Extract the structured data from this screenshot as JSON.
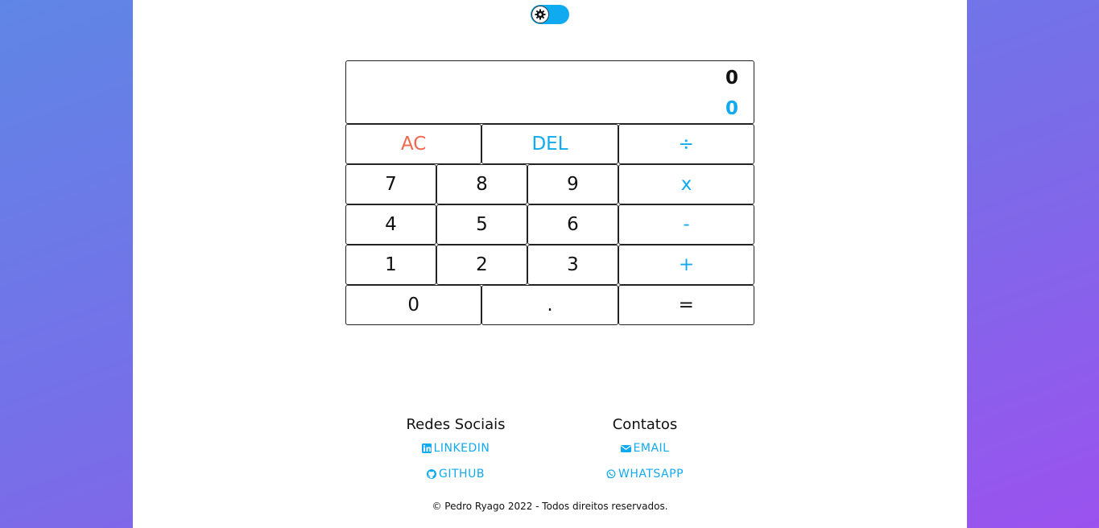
{
  "theme_toggle": {
    "icon": "gear-icon",
    "color": "#10aaf0"
  },
  "display": {
    "previous": "0",
    "current": "0"
  },
  "keys": {
    "ac": "AC",
    "del": "DEL",
    "divide": "÷",
    "seven": "7",
    "eight": "8",
    "nine": "9",
    "multiply": "x",
    "four": "4",
    "five": "5",
    "six": "6",
    "minus": "-",
    "one": "1",
    "two": "2",
    "three": "3",
    "plus": "+",
    "zero": "0",
    "dot": ".",
    "equals": "="
  },
  "footer": {
    "social_title": "Redes Sociais",
    "linkedin": "LINKEDIN",
    "github": "GITHUB",
    "contacts_title": "Contatos",
    "email": "EMAIL",
    "whatsapp": "WHATSAPP",
    "copyright": "© Pedro Ryago 2022 - Todos direitos reservados."
  },
  "colors": {
    "accent": "#10aaf0",
    "clear": "#f0674e"
  }
}
